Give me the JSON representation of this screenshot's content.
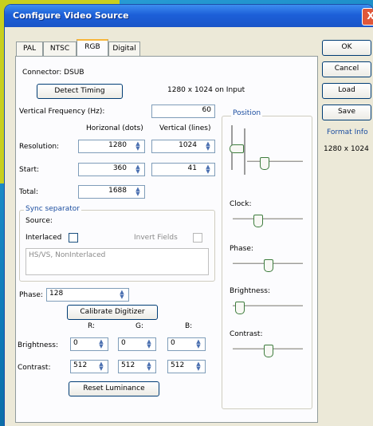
{
  "window": {
    "title": "Configure Video Source",
    "close_label": "X"
  },
  "tabs": [
    {
      "label": "PAL",
      "active": false
    },
    {
      "label": "NTSC",
      "active": false
    },
    {
      "label": "RGB",
      "active": true
    },
    {
      "label": "Digital",
      "active": false
    }
  ],
  "side_buttons": {
    "ok": "OK",
    "cancel": "Cancel",
    "load": "Load",
    "save": "Save"
  },
  "format_info": {
    "label": "Format Info",
    "value": "1280 x 1024"
  },
  "rgb": {
    "connector": "Connector: DSUB",
    "detect_button": "Detect Timing",
    "input_info": "1280 x 1024 on Input",
    "vfreq_label": "Vertical Frequency (Hz):",
    "vfreq_value": "60",
    "col_horizontal": "Horizonal (dots)",
    "col_vertical": "Vertical (lines)",
    "resolution_label": "Resolution:",
    "resolution_h": "1280",
    "resolution_v": "1024",
    "start_label": "Start:",
    "start_h": "360",
    "start_v": "41",
    "total_label": "Total:",
    "total_h": "1688",
    "sync": {
      "group_label": "Sync separator",
      "source_label": "Source:",
      "interlaced_label": "Interlaced",
      "invert_label": "Invert Fields",
      "source_value": "HS/VS, NonInterlaced"
    },
    "phase_label": "Phase:",
    "phase_value": "128",
    "calibrate_button": "Calibrate Digitizer",
    "rgb_headers": {
      "r": "R:",
      "g": "G:",
      "b": "B:"
    },
    "brightness_label": "Brightness:",
    "brightness": [
      "0",
      "0",
      "0"
    ],
    "contrast_label": "Contrast:",
    "contrast": [
      "512",
      "512",
      "512"
    ],
    "reset_button": "Reset Luminance"
  },
  "sliders": {
    "position_label": "Position",
    "clock_label": "Clock:",
    "phase_label": "Phase:",
    "brightness_label": "Brightness:",
    "contrast_label": "Contrast:",
    "clock_level": 0.33,
    "phase_level": 0.5,
    "brightness_level": 0.04,
    "contrast_level": 0.5
  },
  "colors": {
    "titlebar": "#1c5fd8",
    "accent": "#f7b53a",
    "label_blue": "#1c4ea0"
  }
}
